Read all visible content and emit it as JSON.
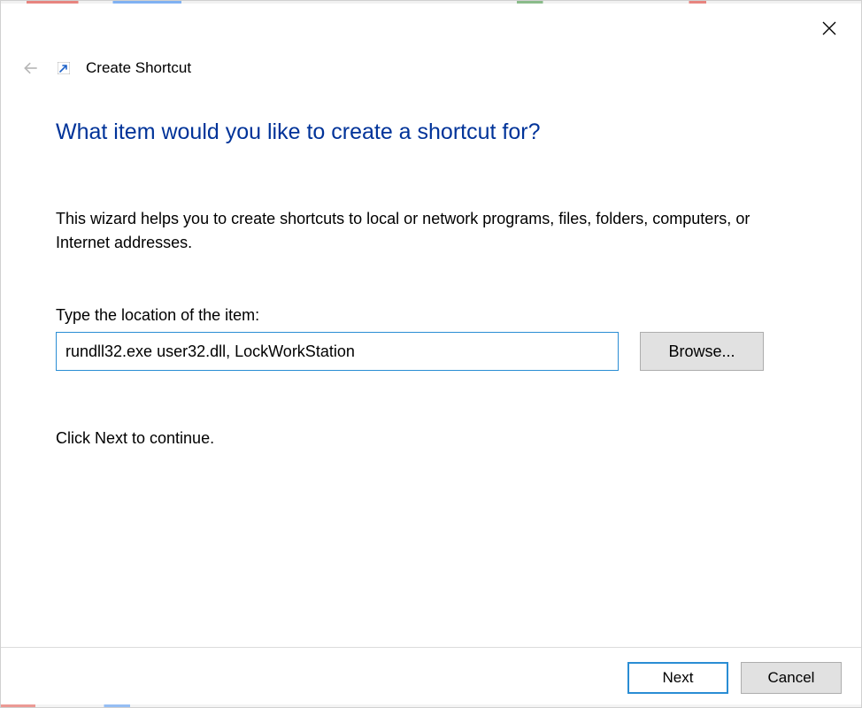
{
  "window": {
    "title": "Create Shortcut"
  },
  "main": {
    "heading": "What item would you like to create a shortcut for?",
    "description": "This wizard helps you to create shortcuts to local or network programs, files, folders, computers, or Internet addresses.",
    "field_label": "Type the location of the item:",
    "location_value": "rundll32.exe user32.dll, LockWorkStation",
    "browse_label": "Browse...",
    "continue_text": "Click Next to continue."
  },
  "footer": {
    "next_label": "Next",
    "cancel_label": "Cancel"
  }
}
